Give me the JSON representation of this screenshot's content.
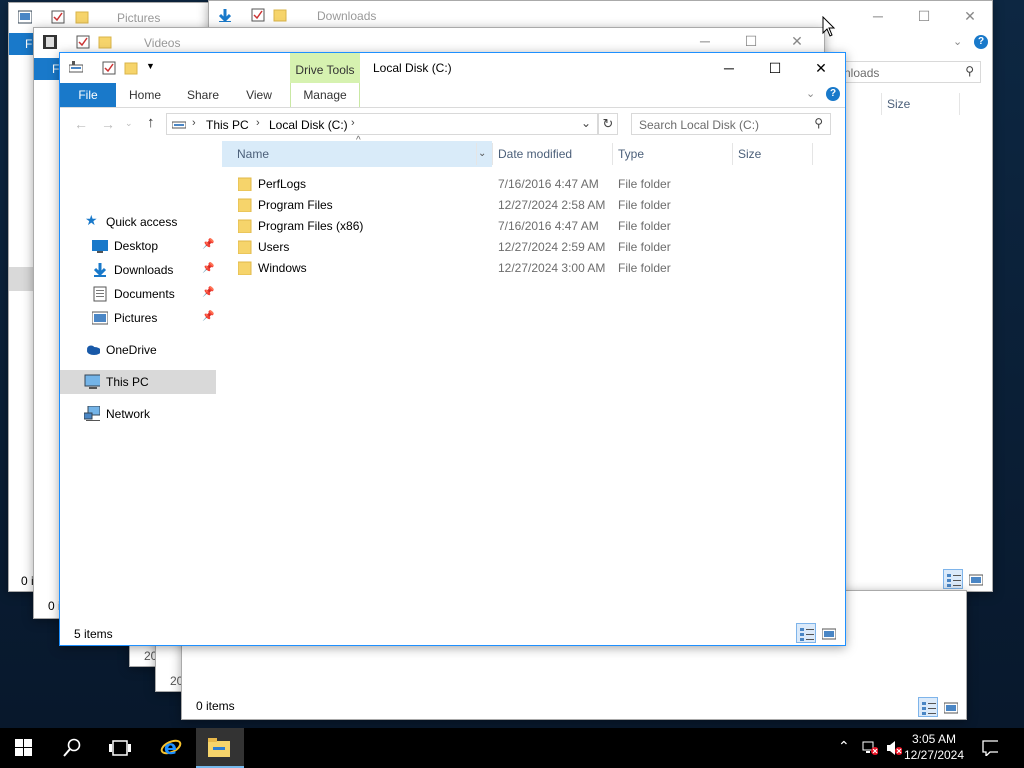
{
  "windows": {
    "pictures": {
      "title": "Pictures",
      "status": "0 i",
      "ribbon_file": "F"
    },
    "downloads": {
      "title": "Downloads",
      "search_placeholder": "nloads",
      "size_col": "Size",
      "status": "0 items"
    },
    "videos": {
      "title": "Videos",
      "status": "0 i",
      "ribbon_file": "F"
    },
    "peek_dates": [
      "20",
      "20"
    ],
    "main": {
      "title": "Local Disk (C:)",
      "context_header": "Drive Tools",
      "tabs": [
        "File",
        "Home",
        "Share",
        "View",
        "Manage"
      ],
      "breadcrumb": [
        "This PC",
        "Local Disk (C:)"
      ],
      "search_placeholder": "Search Local Disk (C:)",
      "nav": {
        "quick_access": "Quick access",
        "desktop": "Desktop",
        "downloads": "Downloads",
        "documents": "Documents",
        "pictures": "Pictures",
        "onedrive": "OneDrive",
        "this_pc": "This PC",
        "network": "Network"
      },
      "columns": {
        "name": "Name",
        "date": "Date modified",
        "type": "Type",
        "size": "Size"
      },
      "files": [
        {
          "name": "PerfLogs",
          "date": "7/16/2016 4:47 AM",
          "type": "File folder",
          "size": ""
        },
        {
          "name": "Program Files",
          "date": "12/27/2024 2:58 AM",
          "type": "File folder",
          "size": ""
        },
        {
          "name": "Program Files (x86)",
          "date": "7/16/2016 4:47 AM",
          "type": "File folder",
          "size": ""
        },
        {
          "name": "Users",
          "date": "12/27/2024 2:59 AM",
          "type": "File folder",
          "size": ""
        },
        {
          "name": "Windows",
          "date": "12/27/2024 3:00 AM",
          "type": "File folder",
          "size": ""
        }
      ],
      "status": "5 items"
    }
  },
  "taskbar": {
    "time": "3:05 AM",
    "date": "12/27/2024"
  },
  "colors": {
    "accent": "#1979ca",
    "context_tab": "#d6f2b0",
    "selection": "#d9d9d9",
    "folder": "#f6d46b"
  }
}
